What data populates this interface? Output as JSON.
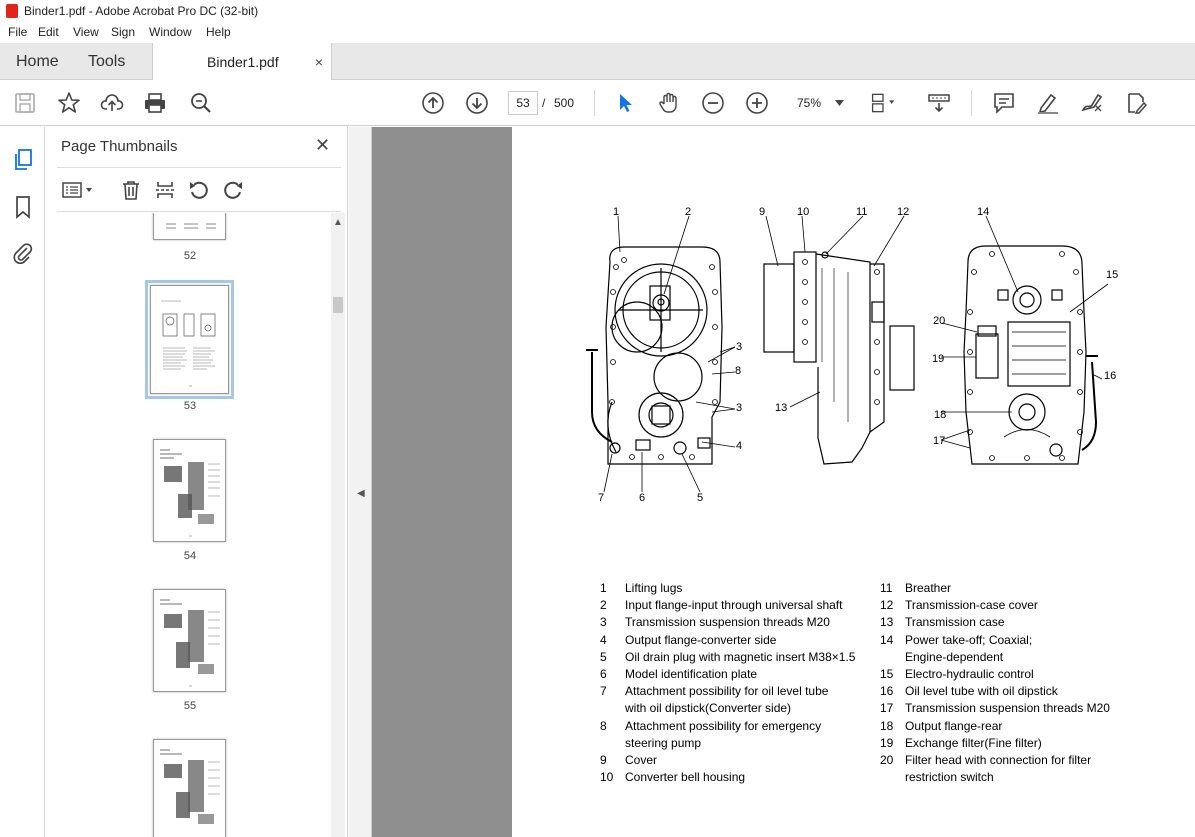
{
  "window": {
    "title": "Binder1.pdf - Adobe Acrobat Pro DC (32-bit)"
  },
  "menu": [
    "File",
    "Edit",
    "View",
    "Sign",
    "Window",
    "Help"
  ],
  "tabs": {
    "home": "Home",
    "tools": "Tools",
    "document": "Binder1.pdf",
    "close": "×"
  },
  "toolbar": {
    "current_page": "53",
    "separator": "/",
    "total_pages": "500",
    "zoom": "75%"
  },
  "panel": {
    "title": "Page Thumbnails",
    "close": "✕",
    "thumbnails": [
      {
        "label": "52",
        "selected": false
      },
      {
        "label": "53",
        "selected": true
      },
      {
        "label": "54",
        "selected": false
      },
      {
        "label": "55",
        "selected": false
      },
      {
        "label": "",
        "selected": false
      }
    ]
  },
  "figure": {
    "callouts": [
      "1",
      "2",
      "9",
      "10",
      "11",
      "12",
      "14",
      "15",
      "20",
      "19",
      "16",
      "3",
      "8",
      "3",
      "13",
      "18",
      "4",
      "17",
      "7",
      "6",
      "5"
    ]
  },
  "legend_left": [
    {
      "num": "1",
      "text": "Lifting lugs"
    },
    {
      "num": "2",
      "text": "Input flange-input through universal shaft"
    },
    {
      "num": "3",
      "text": "Transmission suspension threads M20"
    },
    {
      "num": "4",
      "text": "Output flange-converter side"
    },
    {
      "num": "5",
      "text": "Oil drain plug with magnetic insert M38×1.5"
    },
    {
      "num": "6",
      "text": "Model identification plate"
    },
    {
      "num": "7",
      "text": "Attachment possibility for oil level tube"
    },
    {
      "num": "",
      "text": "with oil dipstick(Converter side)"
    },
    {
      "num": "8",
      "text": "Attachment possibility for emergency"
    },
    {
      "num": "",
      "text": "steering pump"
    },
    {
      "num": "9",
      "text": "Cover"
    },
    {
      "num": "10",
      "text": "Converter bell housing"
    }
  ],
  "legend_right": [
    {
      "num": "11",
      "text": "Breather"
    },
    {
      "num": "12",
      "text": "Transmission-case cover"
    },
    {
      "num": "13",
      "text": "Transmission case"
    },
    {
      "num": "14",
      "text": "Power take-off; Coaxial;"
    },
    {
      "num": "",
      "text": "Engine-dependent"
    },
    {
      "num": "15",
      "text": "Electro-hydraulic control"
    },
    {
      "num": "16",
      "text": "Oil level tube with oil dipstick"
    },
    {
      "num": "17",
      "text": "Transmission suspension threads M20"
    },
    {
      "num": "18",
      "text": "Output flange-rear"
    },
    {
      "num": "19",
      "text": "Exchange filter(Fine filter)"
    },
    {
      "num": "20",
      "text": "Filter head with connection for filter"
    },
    {
      "num": "",
      "text": "restriction switch"
    }
  ],
  "colors": {
    "accent": "#1473e6",
    "selection": "#a8c6e6",
    "doc_bg": "#8f8f8f"
  }
}
